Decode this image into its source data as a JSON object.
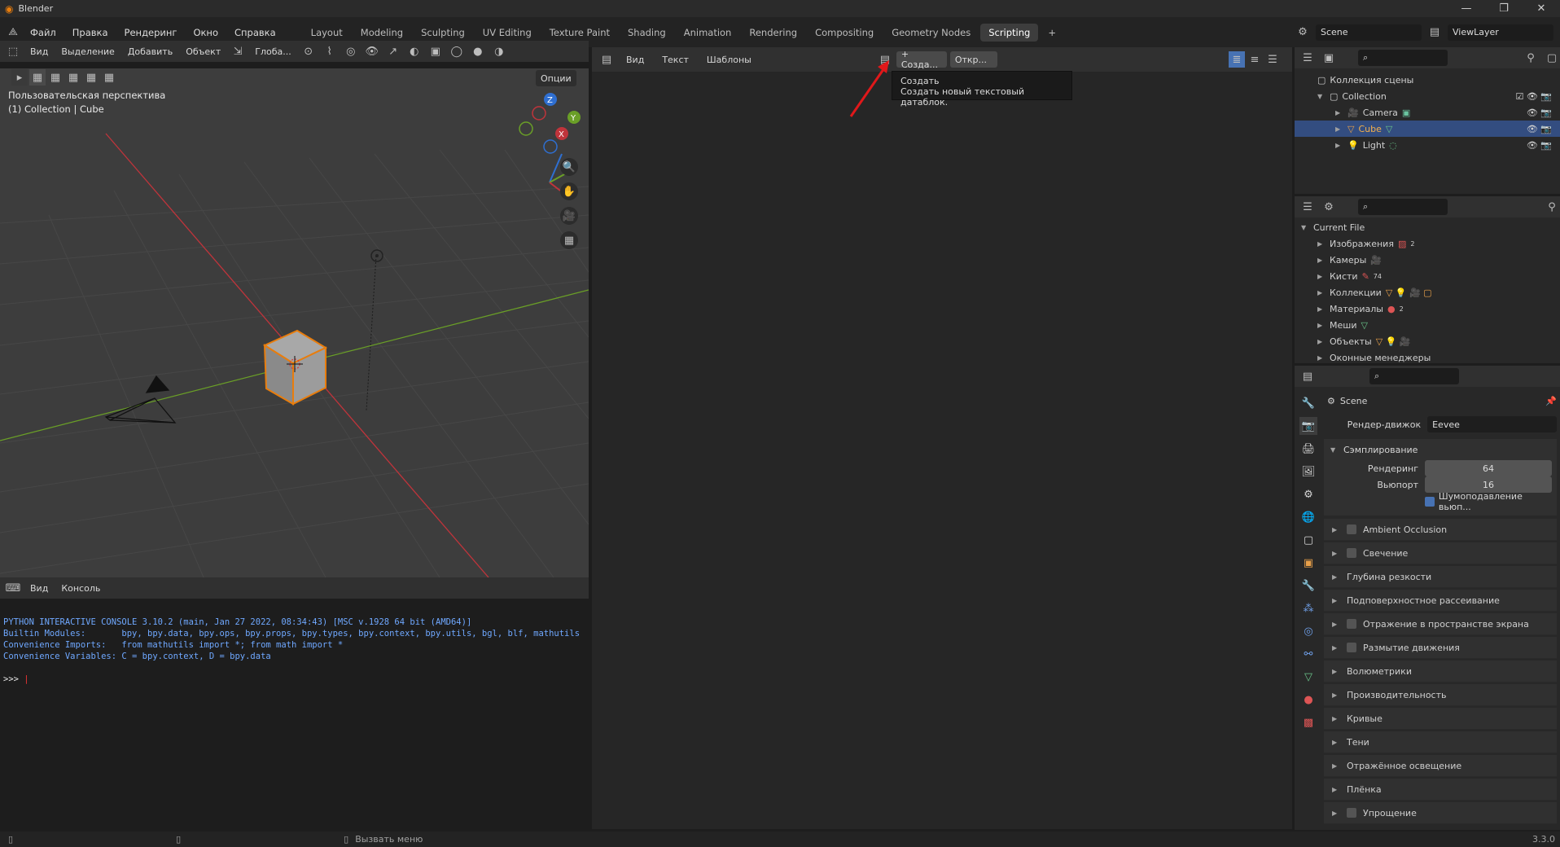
{
  "window": {
    "title": "Blender",
    "controls": [
      "—",
      "❐",
      "✕"
    ]
  },
  "menubar": {
    "items": [
      "Файл",
      "Правка",
      "Рендеринг",
      "Окно",
      "Справка"
    ]
  },
  "workspaces": {
    "tabs": [
      "Layout",
      "Modeling",
      "Sculpting",
      "UV Editing",
      "Texture Paint",
      "Shading",
      "Animation",
      "Rendering",
      "Compositing",
      "Geometry Nodes",
      "Scripting"
    ],
    "active": "Scripting",
    "add": "+"
  },
  "scene": {
    "scene_name": "Scene",
    "view_layer": "ViewLayer"
  },
  "viewport": {
    "header": {
      "view": "Вид",
      "select": "Выделение",
      "add": "Добавить",
      "object": "Объект",
      "orientation": "Глоба...",
      "options": "Опции"
    },
    "overlay_title": "Пользовательская перспектива",
    "overlay_sub": "(1) Collection | Cube",
    "gizmo": {
      "x": "X",
      "y": "Y",
      "z": "Z"
    }
  },
  "console": {
    "header": {
      "view": "Вид",
      "console": "Консоль"
    },
    "lines": [
      "PYTHON INTERACTIVE CONSOLE 3.10.2 (main, Jan 27 2022, 08:34:43) [MSC v.1928 64 bit (AMD64)]",
      "",
      "Builtin Modules:       bpy, bpy.data, bpy.ops, bpy.props, bpy.types, bpy.context, bpy.utils, bgl, blf, mathutils",
      "Convenience Imports:   from mathutils import *; from math import *",
      "Convenience Variables: C = bpy.context, D = bpy.data"
    ],
    "prompt": ">>> "
  },
  "text_editor": {
    "header": {
      "view": "Вид",
      "text": "Текст",
      "templates": "Шаблоны",
      "new": "+ Созда...",
      "open": "Откр..."
    },
    "tooltip": {
      "title": "Создать",
      "body": "Создать новый текстовый датаблок."
    }
  },
  "outliner": {
    "root": "Коллекция сцены",
    "collection": "Collection",
    "items": [
      {
        "name": "Camera",
        "selected": false
      },
      {
        "name": "Cube",
        "selected": true
      },
      {
        "name": "Light",
        "selected": false
      }
    ]
  },
  "blend_file": {
    "root": "Current File",
    "items": [
      {
        "name": "Изображения",
        "badge": "2"
      },
      {
        "name": "Камеры",
        "badge": ""
      },
      {
        "name": "Кисти",
        "badge": "74"
      },
      {
        "name": "Коллекции",
        "badge": ""
      },
      {
        "name": "Материалы",
        "badge": "2"
      },
      {
        "name": "Меши",
        "badge": ""
      },
      {
        "name": "Объекты",
        "badge": ""
      },
      {
        "name": "Оконные менеджеры",
        "badge": ""
      }
    ]
  },
  "properties": {
    "scene": "Scene",
    "engine_label": "Рендер-движок",
    "engine_value": "Eevee",
    "sampling": {
      "title": "Сэмплирование",
      "render_label": "Рендеринг",
      "render_value": "64",
      "viewport_label": "Вьюпорт",
      "viewport_value": "16",
      "denoise": "Шумоподавление вьюп..."
    },
    "panels": [
      {
        "name": "Ambient Occlusion",
        "checkbox": true
      },
      {
        "name": "Свечение",
        "checkbox": true
      },
      {
        "name": "Глубина резкости",
        "checkbox": false
      },
      {
        "name": "Подповерхностное рассеивание",
        "checkbox": false
      },
      {
        "name": "Отражение в пространстве экрана",
        "checkbox": true
      },
      {
        "name": "Размытие движения",
        "checkbox": true
      },
      {
        "name": "Волюметрики",
        "checkbox": false
      },
      {
        "name": "Производительность",
        "checkbox": false
      },
      {
        "name": "Кривые",
        "checkbox": false
      },
      {
        "name": "Тени",
        "checkbox": false
      },
      {
        "name": "Отражённое освещение",
        "checkbox": false
      },
      {
        "name": "Плёнка",
        "checkbox": false
      },
      {
        "name": "Упрощение",
        "checkbox": true
      }
    ]
  },
  "statusbar": {
    "call_menu": "Вызвать меню",
    "version": "3.3.0"
  },
  "colors": {
    "accent": "#e87d0d",
    "selection": "#334d80",
    "axis_x": "#c0343b",
    "axis_y": "#6a9f27",
    "axis_z": "#2f6fd1"
  }
}
